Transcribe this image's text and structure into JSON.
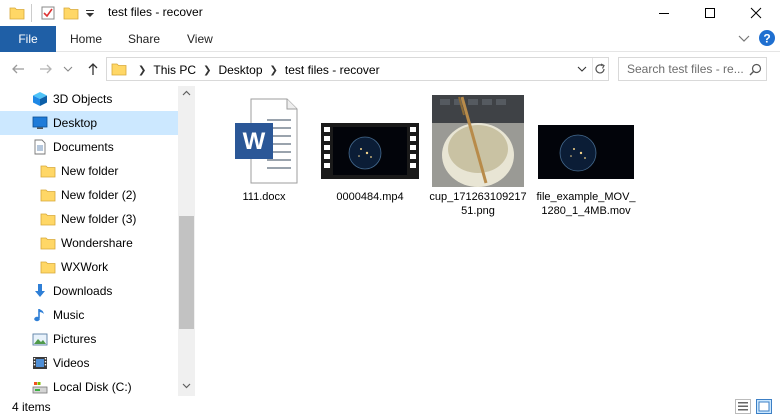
{
  "window": {
    "title": "test files - recover"
  },
  "ribbon": {
    "tabs": [
      {
        "label": "File"
      },
      {
        "label": "Home"
      },
      {
        "label": "Share"
      },
      {
        "label": "View"
      }
    ]
  },
  "address": {
    "crumbs": [
      "This PC",
      "Desktop",
      "test files - recover"
    ]
  },
  "search": {
    "placeholder": "Search test files - re..."
  },
  "sidebar": {
    "items": [
      {
        "label": "3D Objects",
        "icon": "3d-objects-icon"
      },
      {
        "label": "Desktop",
        "icon": "desktop-icon",
        "selected": true
      },
      {
        "label": "Documents",
        "icon": "documents-icon"
      },
      {
        "label": "New folder",
        "icon": "folder-icon"
      },
      {
        "label": "New folder (2)",
        "icon": "folder-icon"
      },
      {
        "label": "New folder (3)",
        "icon": "folder-icon"
      },
      {
        "label": "Wondershare",
        "icon": "folder-icon"
      },
      {
        "label": "WXWork",
        "icon": "folder-icon"
      },
      {
        "label": "Downloads",
        "icon": "downloads-icon"
      },
      {
        "label": "Music",
        "icon": "music-icon"
      },
      {
        "label": "Pictures",
        "icon": "pictures-icon"
      },
      {
        "label": "Videos",
        "icon": "videos-icon"
      },
      {
        "label": "Local Disk (C:)",
        "icon": "local-disk-icon"
      }
    ]
  },
  "files": [
    {
      "name": "111.docx",
      "type": "word-document"
    },
    {
      "name": "0000484.mp4",
      "type": "video"
    },
    {
      "name": "cup_17126310921751.png",
      "type": "image"
    },
    {
      "name": "file_example_MOV_1280_1_4MB.mov",
      "type": "video-still"
    }
  ],
  "status": {
    "item_count": "4 items"
  },
  "colors": {
    "accent": "#1f5fa6",
    "selection": "#cce8ff",
    "folder": "#ffd766"
  }
}
